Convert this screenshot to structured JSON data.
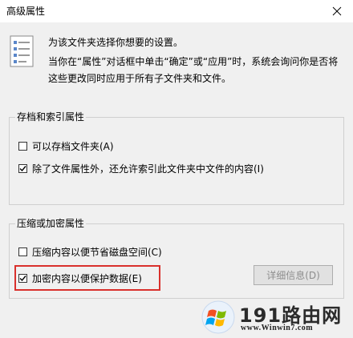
{
  "window": {
    "title": "高级属性",
    "close_glyph": "✕"
  },
  "description": {
    "line1": "为该文件夹选择你想要的设置。",
    "line2": "当你在“属性”对话框中单击“确定”或“应用”时，系统会询问你是否将这些更改同时应用于所有子文件夹和文件。"
  },
  "archive_group": {
    "title": "存档和索引属性",
    "options": [
      {
        "label": "可以存档文件夹(A)",
        "checked": false
      },
      {
        "label": "除了文件属性外，还允许索引此文件夹中文件的内容(I)",
        "checked": true
      }
    ]
  },
  "compress_group": {
    "title": "压缩或加密属性",
    "options": [
      {
        "label": "压缩内容以便节省磁盘空间(C)",
        "checked": false
      },
      {
        "label": "加密内容以便保护数据(E)",
        "checked": true
      }
    ],
    "details_button": "详细信息(D)"
  },
  "watermark": {
    "brand": "191路由网",
    "url": "www.Winwin7.com"
  },
  "colors": {
    "highlight_border": "#d9302c",
    "dialog_bg": "#f0f0f0",
    "disabled_text": "#8d8d8d"
  }
}
